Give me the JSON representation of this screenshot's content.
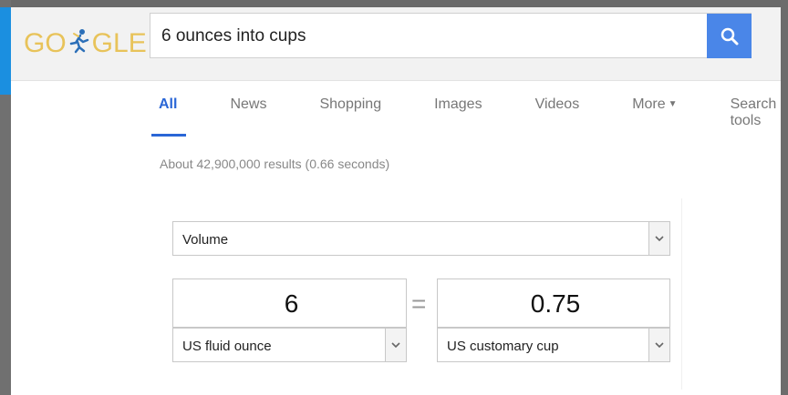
{
  "logo": {
    "left_text": "GO",
    "right_text": "GLE"
  },
  "search": {
    "query": "6 ounces into cups"
  },
  "tabs": [
    {
      "label": "All"
    },
    {
      "label": "News"
    },
    {
      "label": "Shopping"
    },
    {
      "label": "Images"
    },
    {
      "label": "Videos"
    },
    {
      "label": "More"
    },
    {
      "label": "Search tools"
    }
  ],
  "stats": "About 42,900,000 results (0.66 seconds)",
  "converter": {
    "category": "Volume",
    "from_value": "6",
    "from_unit": "US fluid ounce",
    "equals": "=",
    "to_value": "0.75",
    "to_unit": "US customary cup"
  },
  "colors": {
    "accent": "#4a86e8",
    "tab_active": "#2a66d6",
    "logo": "#e8c35a"
  }
}
